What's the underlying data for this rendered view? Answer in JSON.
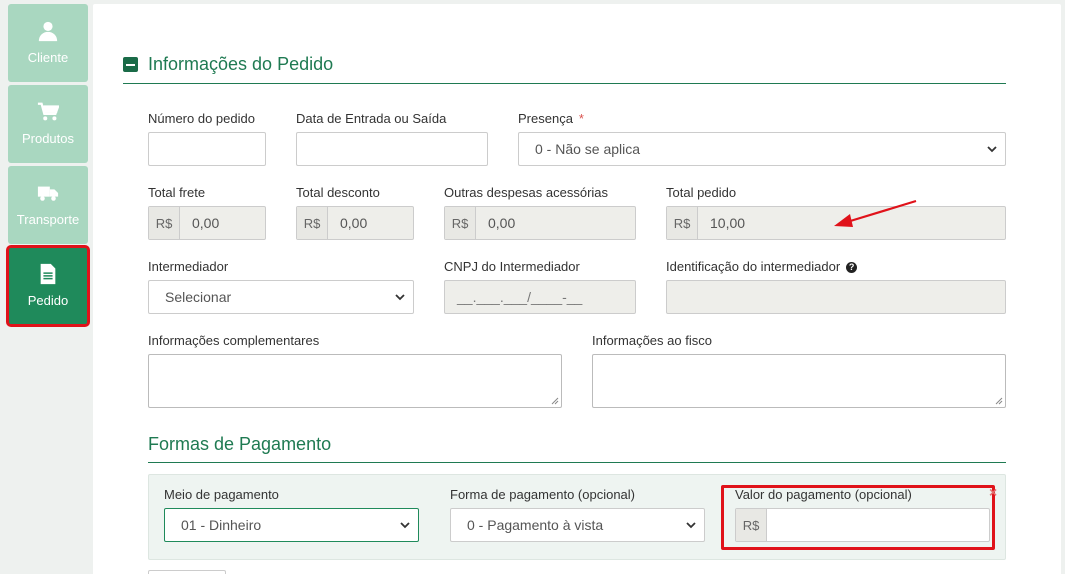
{
  "sidebar": {
    "items": [
      {
        "label": "Cliente",
        "icon": "user-icon",
        "active": false
      },
      {
        "label": "Produtos",
        "icon": "cart-icon",
        "active": false
      },
      {
        "label": "Transporte",
        "icon": "truck-icon",
        "active": false
      },
      {
        "label": "Pedido",
        "icon": "document-icon",
        "active": true
      }
    ]
  },
  "order": {
    "title": "Informações do Pedido",
    "numero_label": "Número do pedido",
    "numero_value": "",
    "data_label": "Data de Entrada ou Saída",
    "data_value": "",
    "presenca_label": "Presença",
    "presenca_required": "*",
    "presenca_value": "0 - Não se aplica",
    "currency": "R$",
    "frete_label": "Total frete",
    "frete_value": "0,00",
    "desconto_label": "Total desconto",
    "desconto_value": "0,00",
    "outras_label": "Outras despesas acessórias",
    "outras_value": "0,00",
    "total_label": "Total pedido",
    "total_value": "10,00",
    "intermediador_label": "Intermediador",
    "intermediador_value": "Selecionar",
    "cnpj_label": "CNPJ do Intermediador",
    "cnpj_placeholder": "__.___.___/____-__",
    "ident_label": "Identificação do intermediador",
    "ident_help": "?",
    "compl_label": "Informações complementares",
    "fisco_label": "Informações ao fisco"
  },
  "payment": {
    "title": "Formas de Pagamento",
    "meio_label": "Meio de pagamento",
    "meio_value": "01 - Dinheiro",
    "forma_label": "Forma de pagamento (opcional)",
    "forma_value": "0 - Pagamento à vista",
    "valor_label": "Valor do pagamento (opcional)",
    "currency": "R$",
    "valor_value": "",
    "remove_glyph": "×"
  },
  "colors": {
    "accent": "#1f8a5b",
    "highlight": "#e0121a"
  }
}
